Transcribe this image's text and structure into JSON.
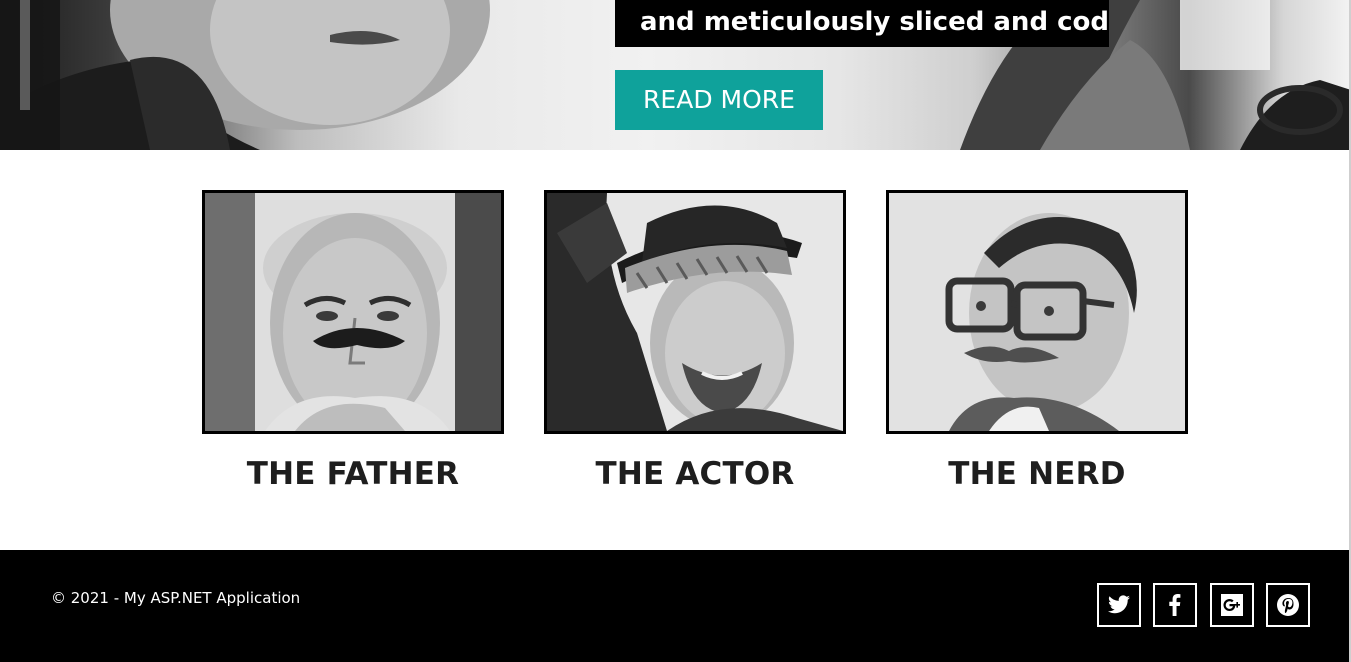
{
  "hero": {
    "caption": "and meticulously sliced and coded.",
    "button_label": "READ MORE"
  },
  "profiles": [
    {
      "name": "THE FATHER"
    },
    {
      "name": "THE ACTOR"
    },
    {
      "name": "THE NERD"
    }
  ],
  "footer": {
    "copyright": "© 2021 - My ASP.NET Application",
    "social": [
      "twitter-icon",
      "facebook-icon",
      "google-plus-icon",
      "pinterest-icon"
    ]
  },
  "colors": {
    "accent": "#0fa29b",
    "footer_bg": "#000000",
    "caption_bg": "#000000"
  }
}
